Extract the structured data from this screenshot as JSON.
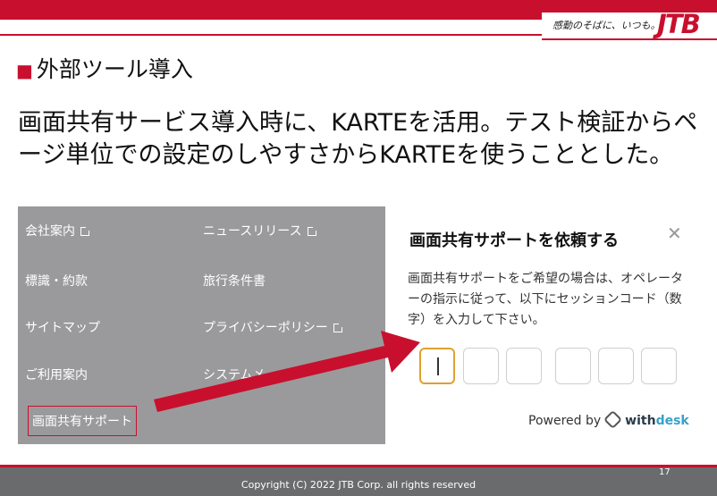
{
  "header": {
    "slogan": "感動のそばに、いつも。",
    "logo": "JTB",
    "brand_color": "#c8102e"
  },
  "slide": {
    "section_mark": "■",
    "section_title": "外部ツール導入",
    "body": "画面共有サービス導入時に、KARTEを活用。テスト検証からページ単位での設定のしやすさからKARTEを使うこととした。"
  },
  "footer_links": {
    "company_info": "会社案内",
    "news_release": "ニュースリリース",
    "signs_terms": "標識・約款",
    "travel_conditions": "旅行条件書",
    "sitemap": "サイトマップ",
    "privacy_policy": "プライバシーポリシー",
    "usage_guide": "ご利用案内",
    "system": "システムメ",
    "screen_share_support": "画面共有サポート"
  },
  "modal": {
    "title": "画面共有サポートを依頼する",
    "close_icon": "close-icon",
    "description": "画面共有サポートをご希望の場合は、オペレーターの指示に従って、以下にセッションコード（数字）を入力して下さい。",
    "code_digits": [
      "",
      "",
      "",
      "",
      "",
      ""
    ],
    "powered_by": "Powered by",
    "brand_with": "with",
    "brand_desk": "desk"
  },
  "footer": {
    "copyright": "Copyright (C) 2022 JTB Corp. all rights reserved",
    "page_number": "17"
  }
}
